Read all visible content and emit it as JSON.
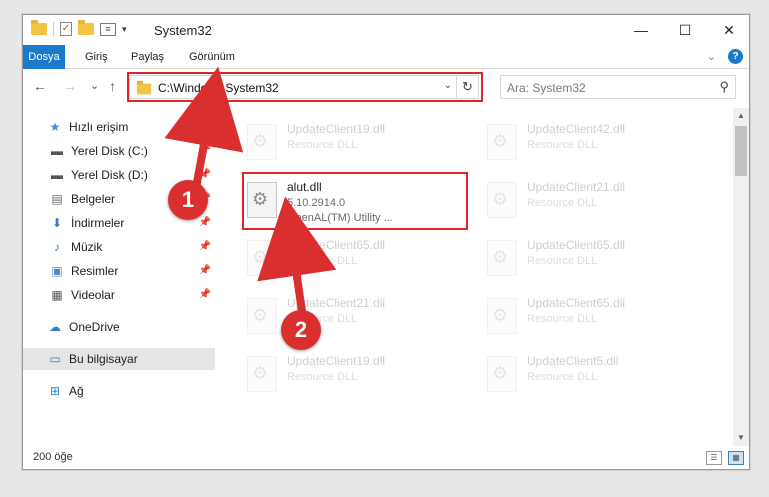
{
  "window": {
    "title": "System32",
    "minimize": "—",
    "maximize": "☐",
    "close": "✕"
  },
  "ribbon": {
    "tabs": [
      "Dosya",
      "Giriş",
      "Paylaş",
      "Görünüm"
    ],
    "help_label": "?"
  },
  "nav": {
    "back": "←",
    "forward": "→",
    "recent": "⌄",
    "up": "↑",
    "address": "C:\\Windows\\System32",
    "refresh": "↻",
    "search_placeholder": "Ara: System32",
    "search_icon": "⚲"
  },
  "sidebar": {
    "items": [
      {
        "label": "Hızlı erişim",
        "icon": "star-icon"
      },
      {
        "label": "Yerel Disk (C:)",
        "icon": "drive-icon"
      },
      {
        "label": "Yerel Disk (D:)",
        "icon": "drive-icon"
      },
      {
        "label": "Belgeler",
        "icon": "document-icon"
      },
      {
        "label": "İndirmeler",
        "icon": "download-icon"
      },
      {
        "label": "Müzik",
        "icon": "music-icon"
      },
      {
        "label": "Resimler",
        "icon": "pictures-icon"
      },
      {
        "label": "Videolar",
        "icon": "video-icon"
      },
      {
        "label": "OneDrive",
        "icon": "cloud-icon"
      },
      {
        "label": "Bu bilgisayar",
        "icon": "computer-icon"
      },
      {
        "label": "Ağ",
        "icon": "network-icon"
      }
    ]
  },
  "files": {
    "left": [
      {
        "name": "UpdateClient19.dll",
        "desc": "Resource DLL"
      },
      {
        "name": "UpdateClient65.dll",
        "desc": "Resource DLL"
      },
      {
        "name": "UpdateClient21.dll",
        "desc": "Resource DLL"
      },
      {
        "name": "UpdateClient19.dll",
        "desc": "Resource DLL"
      }
    ],
    "right": [
      {
        "name": "UpdateClient42.dll",
        "desc": "Resource DLL"
      },
      {
        "name": "UpdateClient21.dll",
        "desc": "Resource DLL"
      },
      {
        "name": "UpdateClient65.dll",
        "desc": "Resource DLL"
      },
      {
        "name": "UpdateClient65.dll",
        "desc": "Resource DLL"
      },
      {
        "name": "UpdateClient5.dll",
        "desc": "Resource DLL"
      }
    ],
    "highlighted": {
      "name": "alut.dll",
      "version": "5.10.2914.0",
      "desc": "OpenAL(TM) Utility ..."
    }
  },
  "status": {
    "count": "200 öğe"
  },
  "annotations": {
    "badge1": "1",
    "badge2": "2",
    "color": "#d9302f"
  }
}
